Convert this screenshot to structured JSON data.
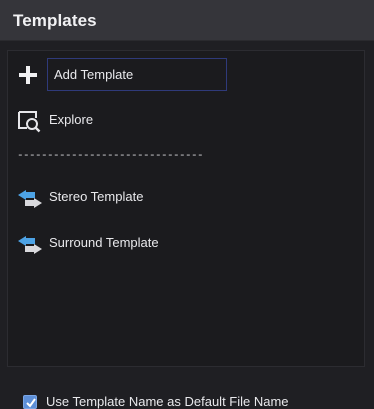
{
  "header": {
    "title": "Templates"
  },
  "actions": [
    {
      "label": "Add Template",
      "icon": "plus-icon"
    },
    {
      "label": "Explore",
      "icon": "explore-icon"
    }
  ],
  "separator": "-------------------------------",
  "templates": [
    {
      "label": "Stereo Template",
      "icon": "stereo-template-icon"
    },
    {
      "label": "Surround Template",
      "icon": "surround-template-icon"
    }
  ],
  "footer": {
    "checkbox_label": "Use Template Name as Default File Name",
    "checked": true
  },
  "colors": {
    "panel_bg": "#1f1f23",
    "header_bg": "#35353a",
    "accent": "#5d8fd8",
    "focus_border": "#2f3a7a"
  }
}
